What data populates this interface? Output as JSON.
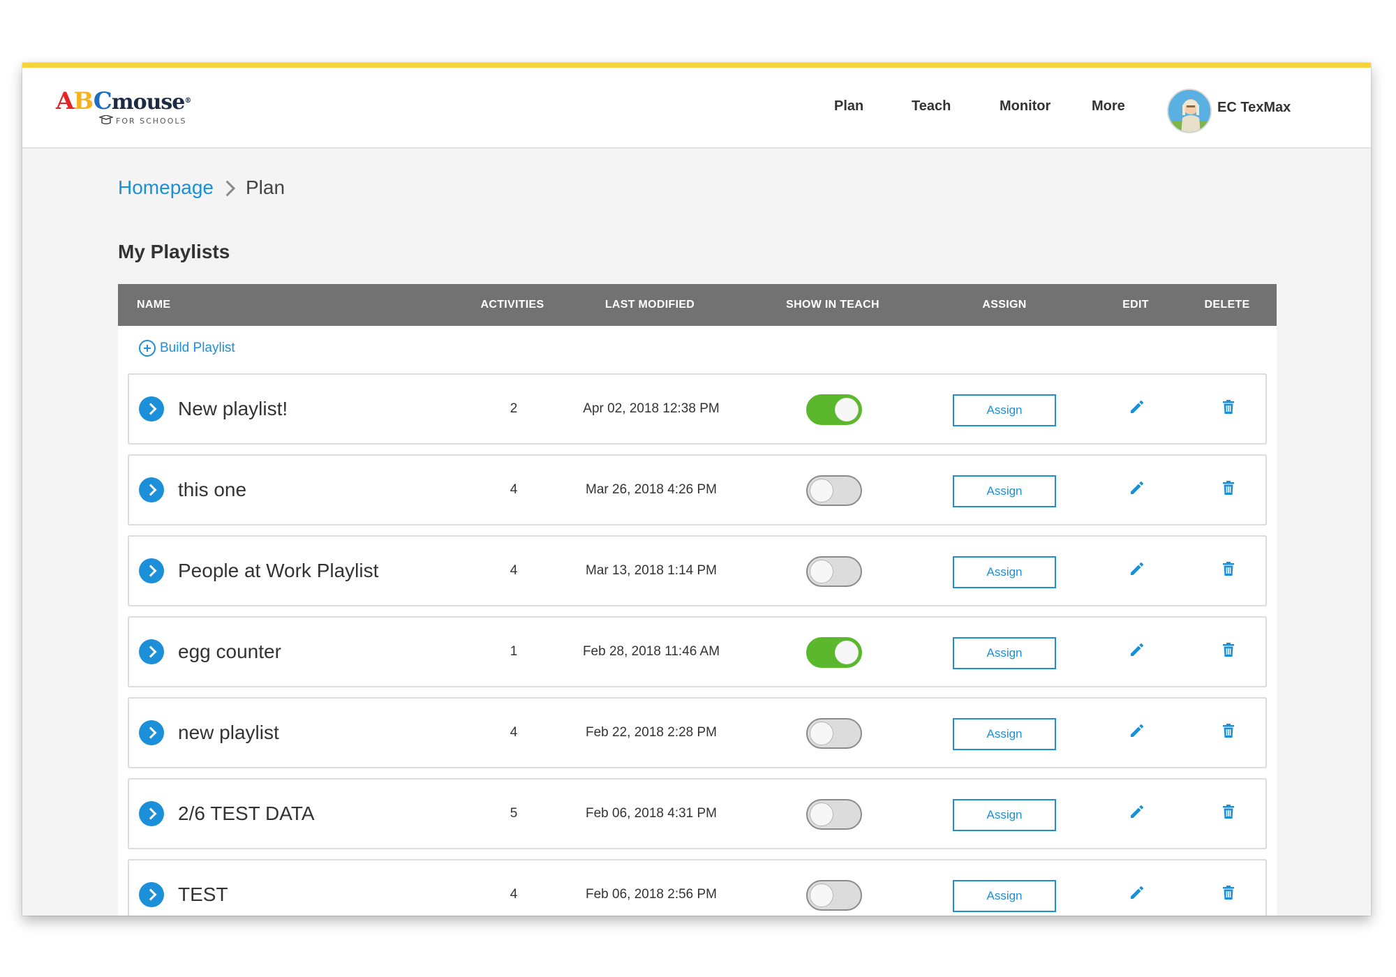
{
  "header": {
    "logo": {
      "a": "A",
      "b": "B",
      "c": "C",
      "rest": "mouse",
      "reg": "®",
      "sub": "FOR SCHOOLS"
    },
    "nav": [
      {
        "label": "Plan"
      },
      {
        "label": "Teach"
      },
      {
        "label": "Monitor"
      },
      {
        "label": "More"
      }
    ],
    "user": {
      "name": "EC TexMax",
      "avatar_icon": "avatar-icon"
    },
    "accent_color": "#f6d33c"
  },
  "breadcrumb": {
    "home": "Homepage",
    "current": "Plan"
  },
  "page_title": "My Playlists",
  "table": {
    "columns": [
      "NAME",
      "ACTIVITIES",
      "LAST MODIFIED",
      "SHOW IN TEACH",
      "ASSIGN",
      "EDIT",
      "DELETE"
    ],
    "build_label": "Build Playlist",
    "assign_label": "Assign",
    "rows": [
      {
        "name": "New playlist!",
        "activities": "2",
        "modified": "Apr 02, 2018 12:38 PM",
        "show_in_teach": true
      },
      {
        "name": "this one",
        "activities": "4",
        "modified": "Mar 26, 2018 4:26 PM",
        "show_in_teach": false
      },
      {
        "name": "People at Work Playlist",
        "activities": "4",
        "modified": "Mar 13, 2018 1:14 PM",
        "show_in_teach": false
      },
      {
        "name": "egg counter",
        "activities": "1",
        "modified": "Feb 28, 2018 11:46 AM",
        "show_in_teach": true
      },
      {
        "name": "new playlist",
        "activities": "4",
        "modified": "Feb 22, 2018 2:28 PM",
        "show_in_teach": false
      },
      {
        "name": "2/6 TEST DATA",
        "activities": "5",
        "modified": "Feb 06, 2018 4:31 PM",
        "show_in_teach": false
      },
      {
        "name": "TEST",
        "activities": "4",
        "modified": "Feb 06, 2018 2:56 PM",
        "show_in_teach": false
      }
    ]
  },
  "colors": {
    "link": "#1b8fd8",
    "toggle_on": "#5bb82d",
    "header_bar": "#727272"
  }
}
